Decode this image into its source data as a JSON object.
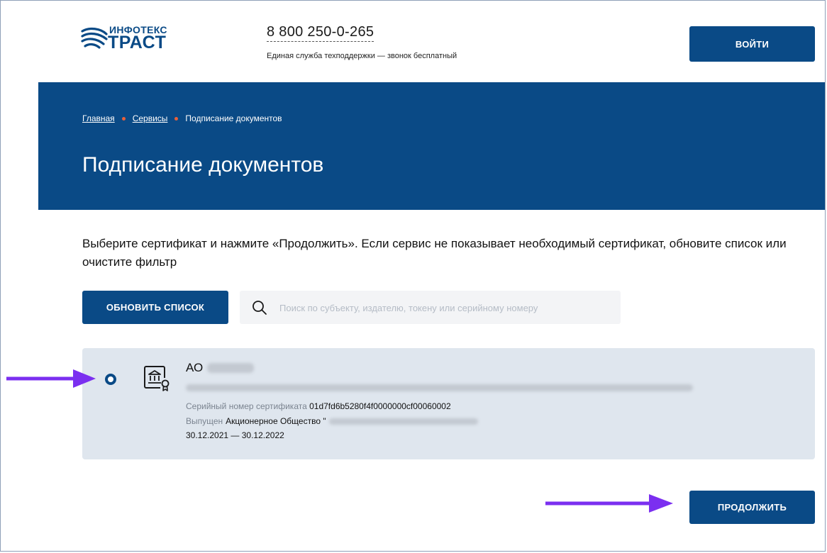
{
  "header": {
    "logo_top": "ИНФОТЕКС",
    "logo_main": "ТРАСТ",
    "phone": "8 800 250-0-265",
    "phone_note": "Единая служба техподдержки — звонок бесплатный",
    "login_label": "ВОЙТИ"
  },
  "breadcrumb": {
    "items": [
      "Главная",
      "Сервисы",
      "Подписание документов"
    ]
  },
  "page": {
    "title": "Подписание документов",
    "instructions": "Выберите сертификат и нажмите «Продолжить». Если сервис не показывает необходимый сертификат, обновите список или очистите фильтр"
  },
  "toolbar": {
    "refresh_label": "ОБНОВИТЬ СПИСОК",
    "search_placeholder": "Поиск по субъекту, издателю, токену или серийному номеру"
  },
  "certificate": {
    "title": "АО",
    "serial_label": "Серийный номер сертификата",
    "serial_value": "01d7fd6b5280f4f0000000cf00060002",
    "issuer_label": "Выпущен",
    "issuer_value": "Акционерное Общество \"",
    "validity": "30.12.2021 — 30.12.2022"
  },
  "actions": {
    "continue_label": "ПРОДОЛЖИТЬ"
  },
  "colors": {
    "brand": "#0a4a86",
    "accent_dot": "#e8603a",
    "annotation_arrow": "#7b2ff0",
    "card_bg": "#dfe6ee"
  }
}
